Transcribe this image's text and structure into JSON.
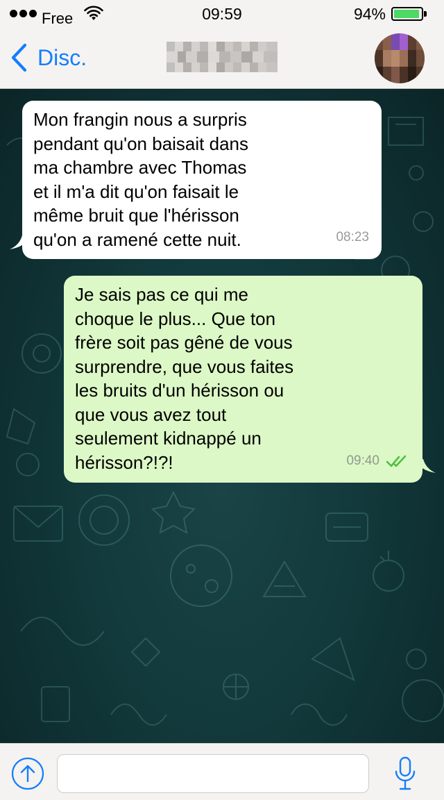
{
  "status_bar": {
    "carrier": "Free",
    "time": "09:59",
    "battery_percent": "94%",
    "battery_level": 0.94
  },
  "nav": {
    "back_label": "Disc.",
    "contact_name": ""
  },
  "messages": [
    {
      "direction": "incoming",
      "text": "Mon frangin nous a surpris\npendant qu'on baisait dans\nma chambre avec Thomas\net il m'a dit qu'on faisait le\nmême bruit que l'hérisson\nqu'on a ramené cette nuit.",
      "time": "08:23"
    },
    {
      "direction": "outgoing",
      "text": "Je sais pas ce qui me\nchoque le plus... Que ton\nfrère soit pas gêné de vous\nsurprendre, que vous faites\nles bruits d'un hérisson ou\nque vous avez tout\nseulement kidnappé un\nhérisson?!?!",
      "time": "09:40",
      "status": "read"
    }
  ],
  "composer": {
    "placeholder": "",
    "value": ""
  },
  "colors": {
    "accent": "#157efb",
    "incoming_bubble": "#ffffff",
    "outgoing_bubble": "#dcf8c6",
    "read_ticks": "#4fc040",
    "battery_fill": "#4cd964",
    "chat_background": "#12393b"
  },
  "icons": {
    "back": "chevron-left-icon",
    "wifi": "wifi-icon",
    "attach": "upload-arrow-icon",
    "mic": "microphone-icon",
    "read": "double-check-icon"
  }
}
